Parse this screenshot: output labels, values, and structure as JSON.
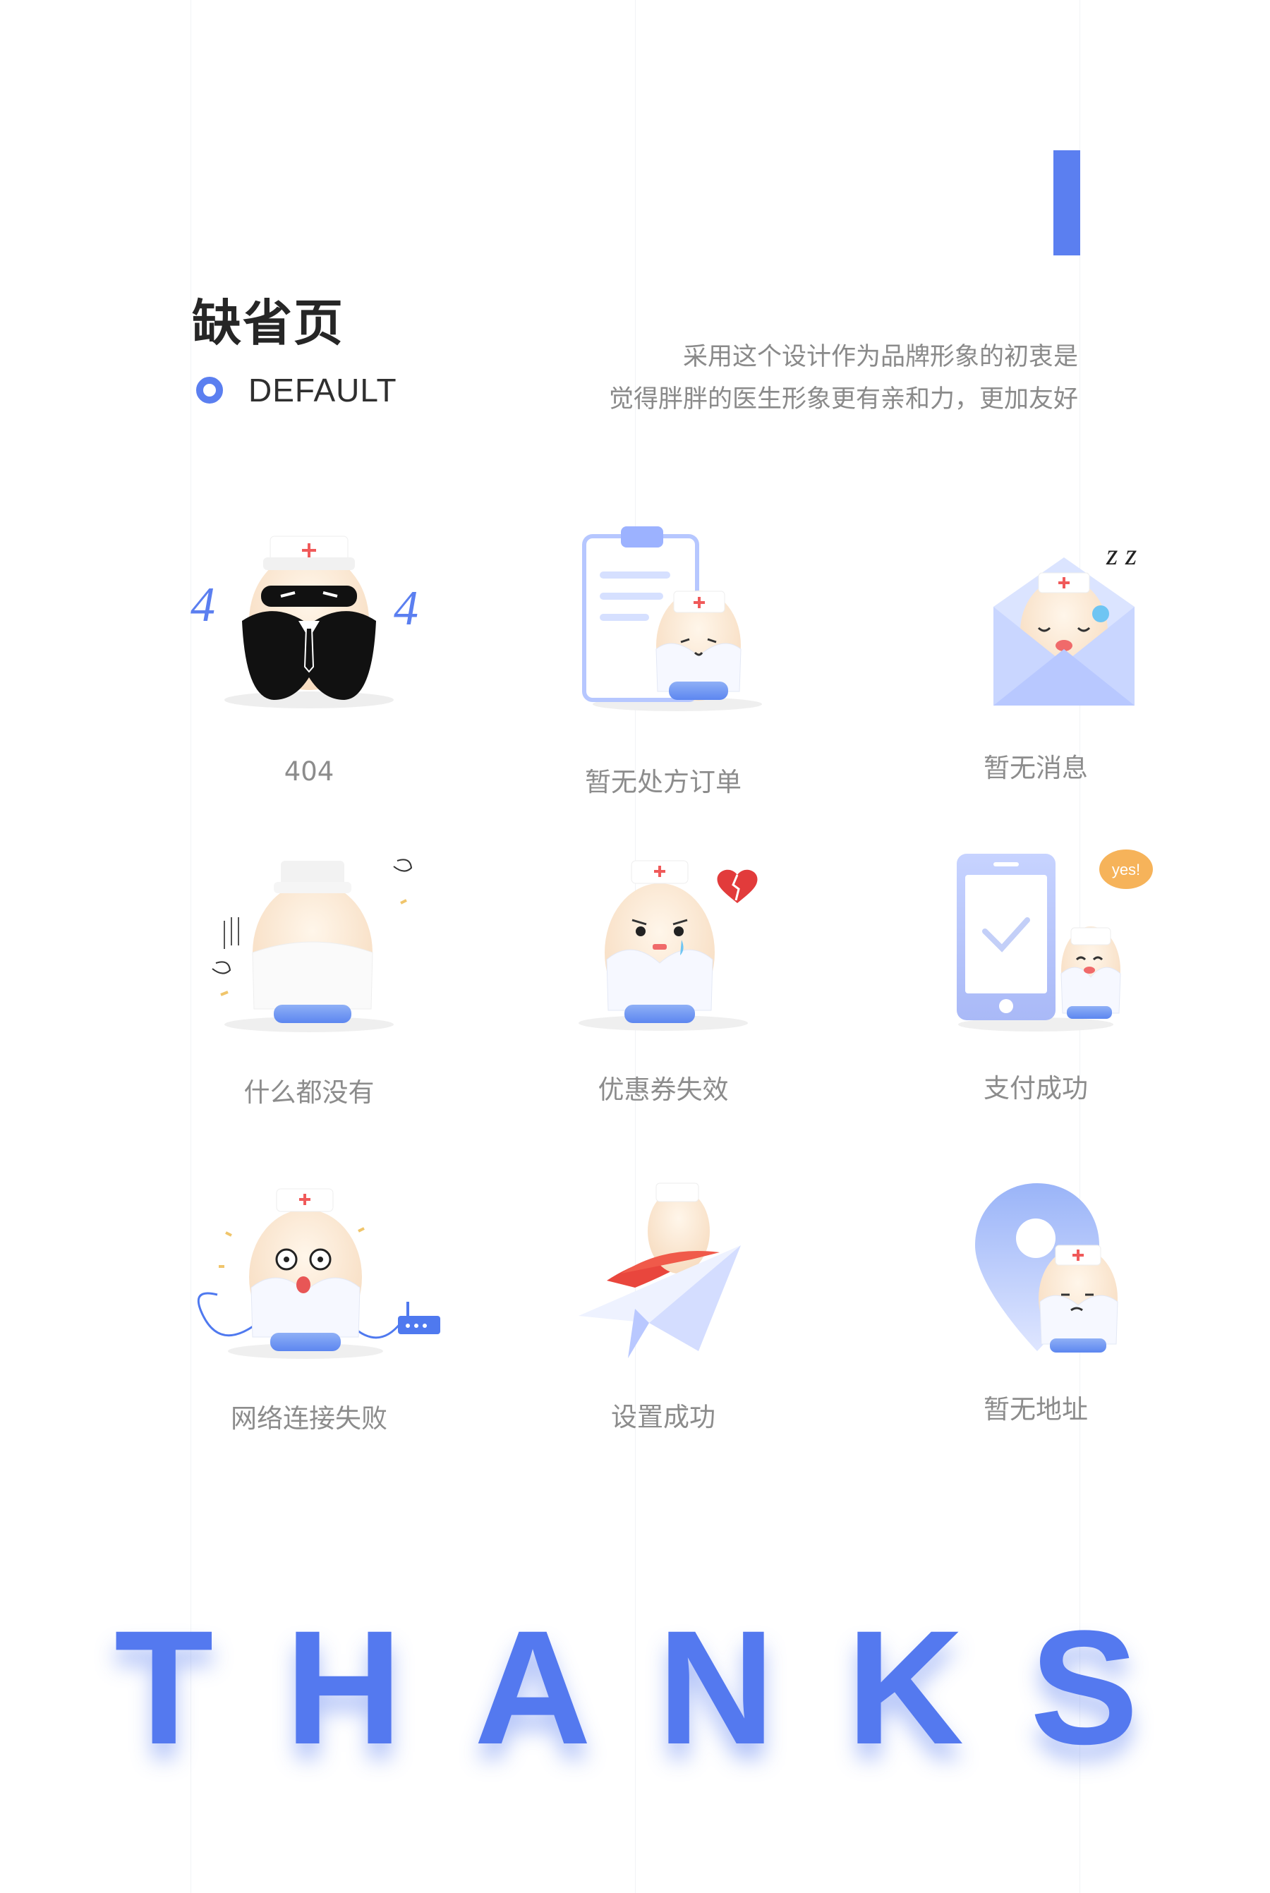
{
  "header": {
    "title": "缺省页",
    "subtitle": "DEFAULT",
    "intro_line1": "采用这个设计作为品牌形象的初衷是",
    "intro_line2": "觉得胖胖的医生形象更有亲和力，更加友好"
  },
  "colors": {
    "accent": "#5b7ff0",
    "caption": "#8c8c8c",
    "thanks": "#5479ef"
  },
  "states": [
    {
      "caption": "404",
      "badge_left": "4",
      "badge_right": "4"
    },
    {
      "caption": "暂无处方订单"
    },
    {
      "caption": "暂无消息",
      "sleep_text": "z z"
    },
    {
      "caption": "什么都没有"
    },
    {
      "caption": "优惠券失效"
    },
    {
      "caption": "支付成功",
      "bubble_text": "yes!"
    },
    {
      "caption": "网络连接失败"
    },
    {
      "caption": "设置成功"
    },
    {
      "caption": "暂无地址"
    }
  ],
  "footer": {
    "letters": [
      "T",
      "H",
      "A",
      "N",
      "K",
      "S"
    ]
  }
}
